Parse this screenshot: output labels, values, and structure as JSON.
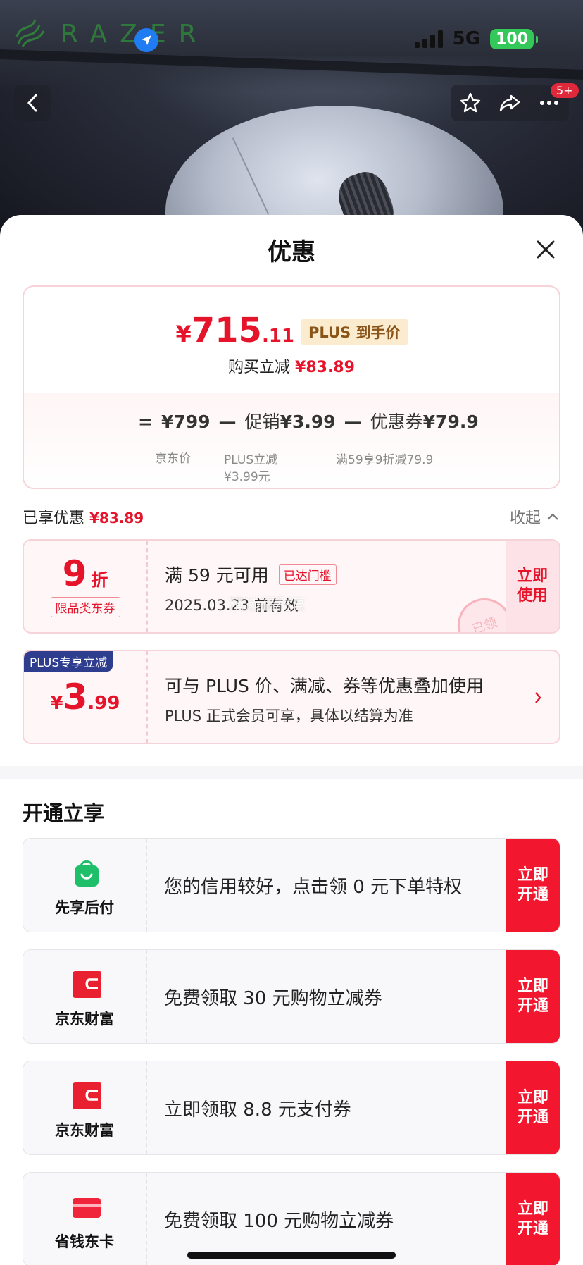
{
  "status_bar": {
    "network": "5G",
    "battery": "100"
  },
  "brand": {
    "name": "RAZER"
  },
  "header": {
    "more_badge": "5+"
  },
  "sheet": {
    "title": "优惠"
  },
  "price_summary": {
    "currency": "¥",
    "price_int": "715",
    "price_dec": ".11",
    "plus_tag": "PLUS 到手价",
    "instant_label": "购买立减",
    "instant_value": "¥83.89",
    "formula": {
      "equals": "=",
      "base_value": "¥799",
      "base_label": "京东价",
      "minus1": "—",
      "promo_label": "促销",
      "promo_value": "¥3.99",
      "promo_note_1": "PLUS立减",
      "promo_note_2": "¥3.99元",
      "minus2": "—",
      "coupon_label": "优惠券",
      "coupon_value": "¥79.9",
      "coupon_note": "满59享9折减79.9"
    }
  },
  "enjoyed": {
    "label": "已享优惠",
    "value": "¥83.89",
    "collapse": "收起"
  },
  "coupons": [
    {
      "big": "9",
      "unit": "折",
      "type": "限品类东券",
      "title": "满 59 元可用",
      "threshold_tag": "已达门槛",
      "expiry": "2025.03.23 前有效",
      "watermark": "精选福利官",
      "stamp": "已领",
      "action_1": "立即",
      "action_2": "使用"
    },
    {
      "ribbon": "PLUS专享立减",
      "currency": "¥",
      "big": "3",
      "dec": ".99",
      "title": "可与 PLUS 价、满减、券等优惠叠加使用",
      "subtitle": "PLUS 正式会员可享，具体以结算为准"
    }
  ],
  "open_section": {
    "title": "开通立享",
    "items": [
      {
        "name": "先享后付",
        "icon": "shopping-bag-icon",
        "desc": "您的信用较好，点击领 0 元下单特权",
        "action_1": "立即",
        "action_2": "开通"
      },
      {
        "name": "京东财富",
        "icon": "wallet-icon",
        "desc": "免费领取 30 元购物立减券",
        "action_1": "立即",
        "action_2": "开通"
      },
      {
        "name": "京东财富",
        "icon": "wallet-icon",
        "desc": "立即领取 8.8 元支付券",
        "action_1": "立即",
        "action_2": "开通"
      },
      {
        "name": "省钱东卡",
        "icon": "card-icon",
        "desc": "免费领取 100 元购物立减券",
        "action_1": "立即",
        "action_2": "开通"
      }
    ]
  },
  "colors": {
    "accent_red": "#e5142b",
    "button_red": "#f2172f",
    "plus_navy": "#2f3d8f",
    "battery_green": "#34c759"
  }
}
